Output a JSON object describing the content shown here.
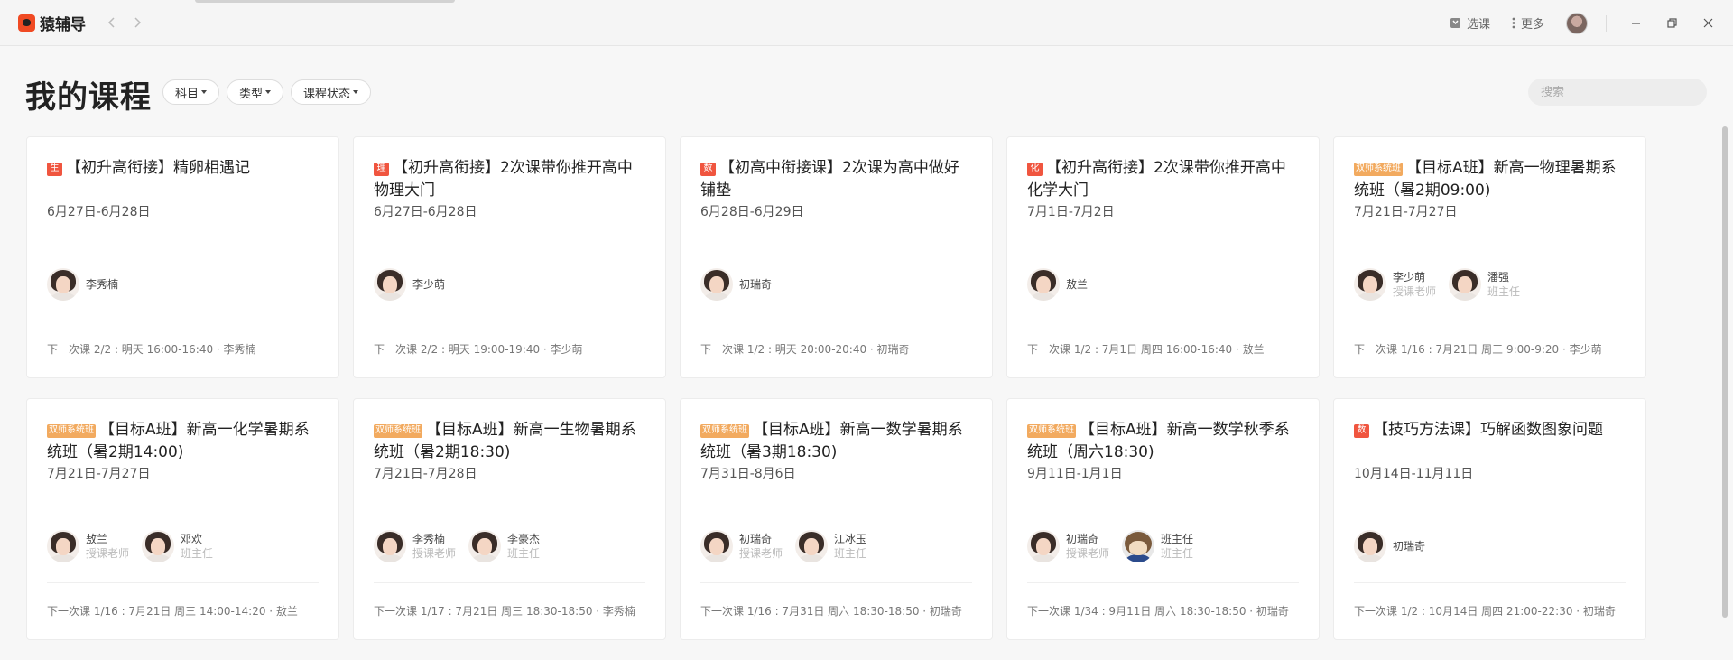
{
  "app": {
    "name": "猿辅导"
  },
  "titlebar": {
    "select_course": "选课",
    "more": "更多"
  },
  "page": {
    "title": "我的课程"
  },
  "filters": [
    {
      "label": "科目"
    },
    {
      "label": "类型"
    },
    {
      "label": "课程状态"
    }
  ],
  "search": {
    "placeholder": "搜索"
  },
  "courses": [
    {
      "badge": "生",
      "badge_color": "#f0553f",
      "title": "【初升高衔接】精卵相遇记",
      "date": "6月27日-6月28日",
      "teachers": [
        {
          "name": "李秀楠",
          "role": ""
        }
      ],
      "next": "下一次课 2/2 : 明天 16:00-16:40 · 李秀楠"
    },
    {
      "badge": "理",
      "badge_color": "#f0553f",
      "title": "【初升高衔接】2次课带你推开高中物理大门",
      "date": "6月27日-6月28日",
      "teachers": [
        {
          "name": "李少萌",
          "role": ""
        }
      ],
      "next": "下一次课 2/2 : 明天 19:00-19:40 · 李少萌"
    },
    {
      "badge": "数",
      "badge_color": "#f0553f",
      "title": "【初高中衔接课】2次课为高中做好铺垫",
      "date": "6月28日-6月29日",
      "teachers": [
        {
          "name": "初瑞奇",
          "role": ""
        }
      ],
      "next": "下一次课 1/2 : 明天 20:00-20:40 · 初瑞奇"
    },
    {
      "badge": "化",
      "badge_color": "#f0553f",
      "title": "【初升高衔接】2次课带你推开高中化学大门",
      "date": "7月1日-7月2日",
      "teachers": [
        {
          "name": "敖兰",
          "role": ""
        }
      ],
      "next": "下一次课 1/2 : 7月1日 周四 16:00-16:40 · 敖兰"
    },
    {
      "badge": "双师系统班",
      "badge_color": "#f2aa5f",
      "title": "【目标A班】新高一物理暑期系统班（暑2期09:00)",
      "date": "7月21日-7月27日",
      "teachers": [
        {
          "name": "李少萌",
          "role": "授课老师"
        },
        {
          "name": "潘强",
          "role": "班主任"
        }
      ],
      "next": "下一次课 1/16 : 7月21日 周三 9:00-9:20 · 李少萌"
    },
    {
      "badge": "双师系统班",
      "badge_color": "#f2aa5f",
      "title": "【目标A班】新高一化学暑期系统班（暑2期14:00)",
      "date": "7月21日-7月27日",
      "teachers": [
        {
          "name": "敖兰",
          "role": "授课老师"
        },
        {
          "name": "邓欢",
          "role": "班主任"
        }
      ],
      "next": "下一次课 1/16 : 7月21日 周三 14:00-14:20 · 敖兰"
    },
    {
      "badge": "双师系统班",
      "badge_color": "#f2aa5f",
      "title": "【目标A班】新高一生物暑期系统班（暑2期18:30)",
      "date": "7月21日-7月28日",
      "teachers": [
        {
          "name": "李秀楠",
          "role": "授课老师"
        },
        {
          "name": "李豪杰",
          "role": "班主任"
        }
      ],
      "next": "下一次课 1/17 : 7月21日 周三 18:30-18:50 · 李秀楠"
    },
    {
      "badge": "双师系统班",
      "badge_color": "#f2aa5f",
      "title": "【目标A班】新高一数学暑期系统班（暑3期18:30)",
      "date": "7月31日-8月6日",
      "teachers": [
        {
          "name": "初瑞奇",
          "role": "授课老师"
        },
        {
          "name": "江冰玉",
          "role": "班主任"
        }
      ],
      "next": "下一次课 1/16 : 7月31日 周六 18:30-18:50 · 初瑞奇"
    },
    {
      "badge": "双师系统班",
      "badge_color": "#f2aa5f",
      "title": "【目标A班】新高一数学秋季系统班（周六18:30)",
      "date": "9月11日-1月1日",
      "teachers": [
        {
          "name": "初瑞奇",
          "role": "授课老师"
        },
        {
          "name": "班主任",
          "role": "班主任",
          "mascot": true
        }
      ],
      "next": "下一次课 1/34 : 9月11日 周六 18:30-18:50 · 初瑞奇"
    },
    {
      "badge": "数",
      "badge_color": "#f0553f",
      "title": "【技巧方法课】巧解函数图象问题",
      "date": "10月14日-11月11日",
      "teachers": [
        {
          "name": "初瑞奇",
          "role": ""
        }
      ],
      "next": "下一次课 1/2 : 10月14日 周四 21:00-22:30 · 初瑞奇"
    }
  ]
}
